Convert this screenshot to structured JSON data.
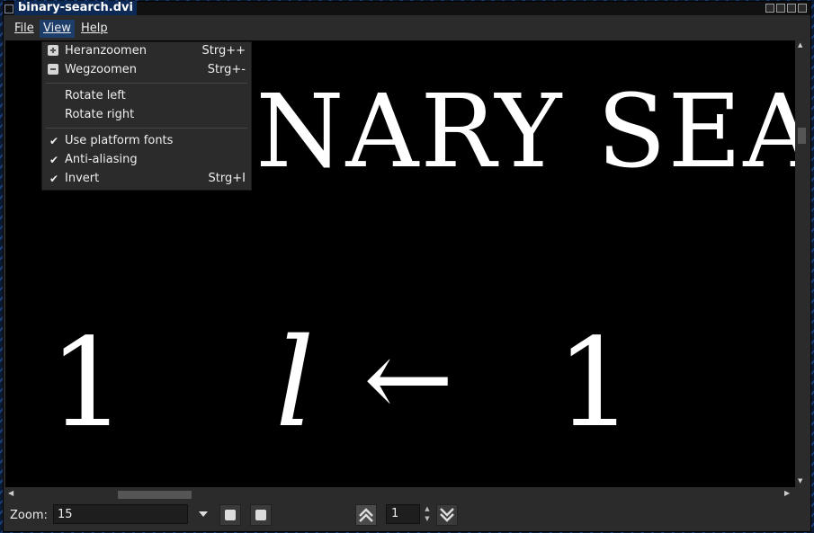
{
  "window": {
    "title": "binary-search.dvi"
  },
  "menubar": {
    "file": "File",
    "view": "View",
    "help": "Help"
  },
  "view_menu": {
    "zoom_in": {
      "label": "Heranzoomen",
      "shortcut": "Strg++"
    },
    "zoom_out": {
      "label": "Wegzoomen",
      "shortcut": "Strg+-"
    },
    "rotate_left": "Rotate left",
    "rotate_right": "Rotate right",
    "platform_fonts": "Use platform fonts",
    "anti_aliasing": "Anti-aliasing",
    "invert": {
      "label": "Invert",
      "shortcut": "Strg+I"
    },
    "checkmark": "✔"
  },
  "document": {
    "heading": "BINARY SEARCH",
    "line_number": "1",
    "var": "l",
    "arrow": "←",
    "value": "1"
  },
  "statusbar": {
    "zoom_label": "Zoom:",
    "zoom_value": "15",
    "page_value": "1"
  }
}
